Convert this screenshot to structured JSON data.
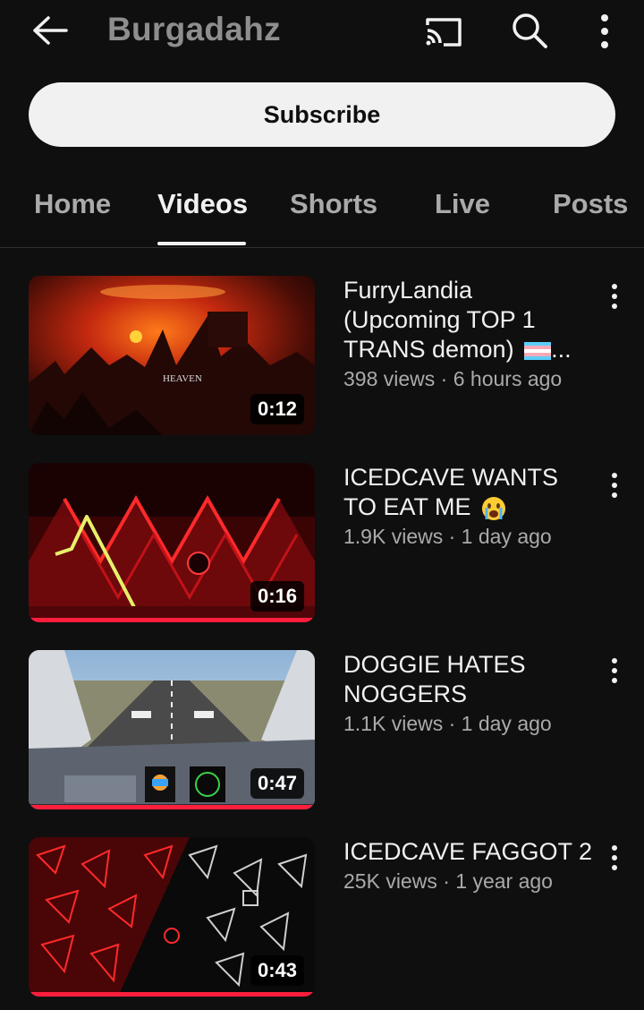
{
  "header": {
    "channel_name": "Burgadahz",
    "icons": [
      "back-arrow",
      "cast",
      "search",
      "more-vertical"
    ]
  },
  "subscribe_label": "Subscribe",
  "tabs": [
    "Home",
    "Videos",
    "Shorts",
    "Live",
    "Posts"
  ],
  "active_tab": "Videos",
  "videos": [
    {
      "title": "FurryLandia (Upcoming TOP 1 TRANS demon)",
      "title_suffix": "...",
      "views": "398 views",
      "age": "6 hours ago",
      "duration": "0:12",
      "watched": false
    },
    {
      "title": "ICEDCAVE WANTS TO EAT ME",
      "views": "1.9K views",
      "age": "1 day ago",
      "duration": "0:16",
      "watched": true
    },
    {
      "title": "DOGGIE HATES NOGGERS",
      "views": "1.1K views",
      "age": "1 day ago",
      "duration": "0:47",
      "watched": true
    },
    {
      "title": "ICEDCAVE FAGGOT 2",
      "views": "25K views",
      "age": "1 year ago",
      "duration": "0:43",
      "watched": true
    }
  ],
  "meta_separator": " · ",
  "colors": {
    "background": "#0f0f0f",
    "progress": "#ff1f3d",
    "subscribe_bg": "#f1f1f1"
  }
}
